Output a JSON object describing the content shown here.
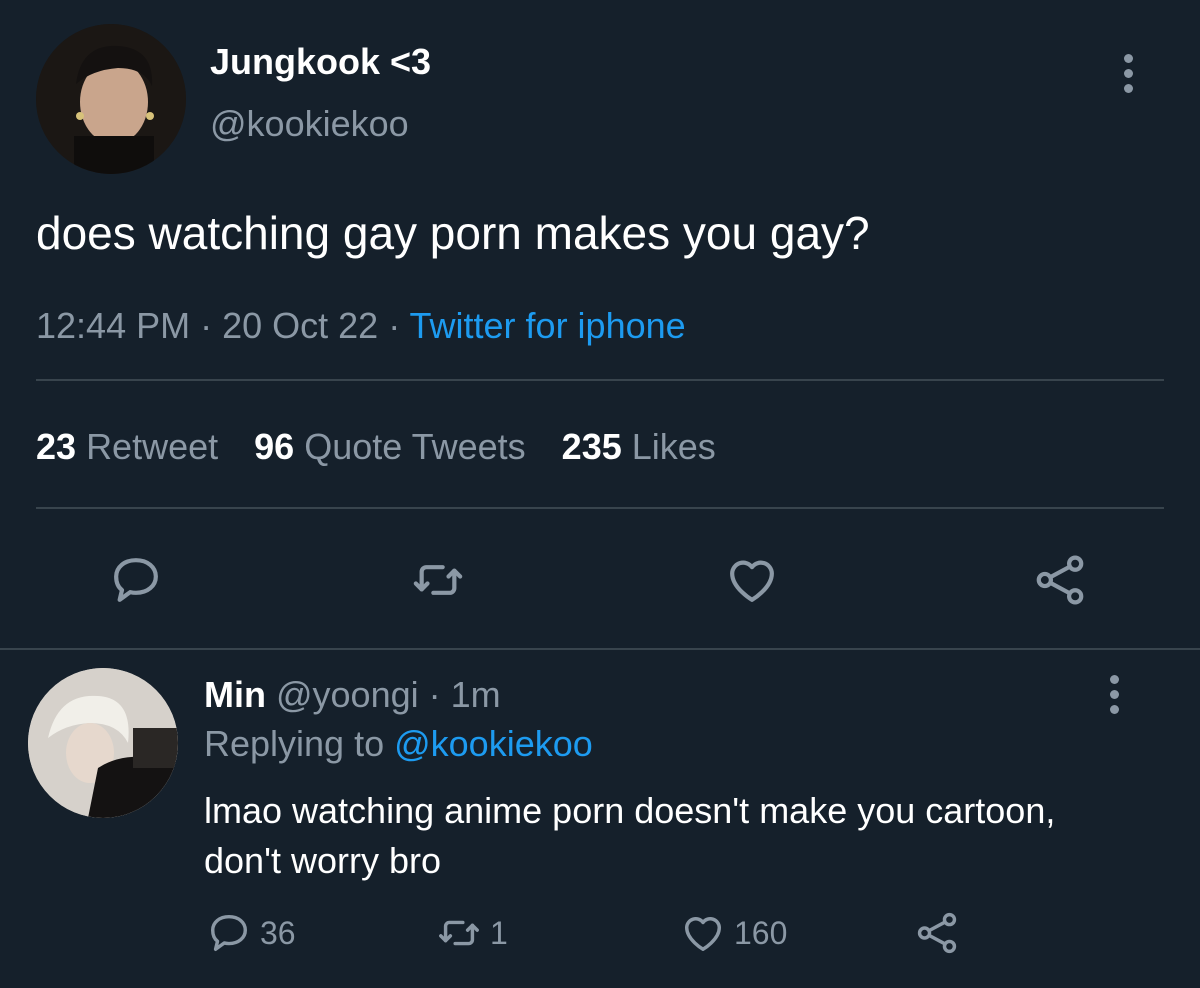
{
  "tweet": {
    "display_name": "Jungkook <3",
    "handle": "@kookiekoo",
    "text": "does watching gay porn makes you gay?",
    "time": "12:44 PM",
    "date": "20 Oct 22",
    "separator": " · ",
    "source": "Twitter for iphone",
    "stats": {
      "retweets_count": "23",
      "retweets_label": "Retweet",
      "quotes_count": "96",
      "quotes_label": "Quote Tweets",
      "likes_count": "235",
      "likes_label": "Likes"
    },
    "avatar_icon": "user-avatar-photo",
    "actions": [
      "reply-icon",
      "retweet-icon",
      "like-icon",
      "share-icon"
    ]
  },
  "reply": {
    "display_name": "Min",
    "handle_time": " @yoongi · 1m",
    "replying_prefix": "Replying to ",
    "replying_to": "@kookiekoo",
    "text": "lmao watching anime porn doesn't make you cartoon, don't worry bro",
    "reply_count": "36",
    "retweet_count": "1",
    "like_count": "160",
    "avatar_icon": "user-avatar-photo"
  },
  "colors": {
    "background": "#15202b",
    "text_primary": "#ffffff",
    "text_secondary": "#8b98a5",
    "accent": "#1d9bf0",
    "divider": "#38444d"
  }
}
